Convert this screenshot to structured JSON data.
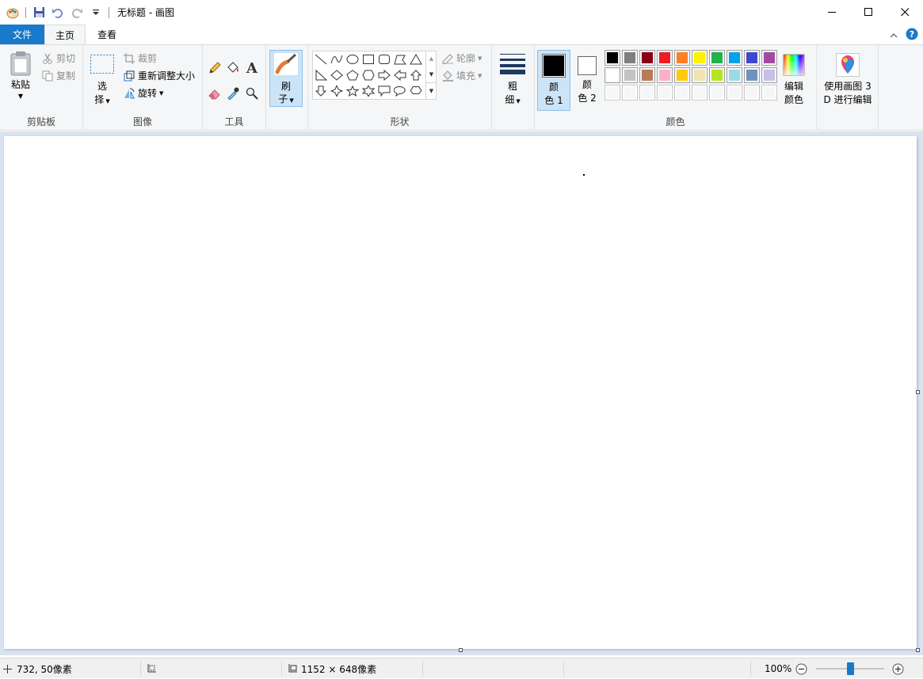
{
  "window": {
    "title": "无标题 - 画图",
    "minimize_glyph": "—",
    "maximize_glyph": "☐",
    "close_glyph": "✕"
  },
  "tabs": {
    "file": "文件",
    "home": "主页",
    "view": "查看"
  },
  "clipboard": {
    "paste": "粘贴",
    "cut": "剪切",
    "copy": "复制",
    "group_label": "剪贴板"
  },
  "image": {
    "select_line1": "选",
    "select_line2": "择",
    "crop": "裁剪",
    "resize": "重新调整大小",
    "rotate": "旋转",
    "group_label": "图像"
  },
  "tools": {
    "group_label": "工具",
    "text_glyph": "A"
  },
  "brushes": {
    "line1": "刷",
    "line2": "子"
  },
  "shapes": {
    "outline": "轮廓",
    "fill": "填充",
    "group_label": "形状"
  },
  "size": {
    "line1": "粗",
    "line2": "细"
  },
  "colors": {
    "color1_line1": "颜",
    "color1_line2": "色 1",
    "color2_line1": "颜",
    "color2_line2": "色 2",
    "edit_line1": "编辑",
    "edit_line2": "颜色",
    "group_label": "颜色",
    "color1_value": "#000000",
    "color2_value": "#ffffff",
    "palette_row1": [
      "#000000",
      "#7f7f7f",
      "#880015",
      "#ed1c24",
      "#ff7f27",
      "#fff200",
      "#22b14c",
      "#00a2e8",
      "#3f48cc",
      "#a349a4"
    ],
    "palette_row2": [
      "#ffffff",
      "#c3c3c3",
      "#b97a57",
      "#ffaec9",
      "#ffc90e",
      "#efe4b0",
      "#b5e61d",
      "#99d9ea",
      "#7092be",
      "#c8bfe7"
    ],
    "palette_row3": [
      "#f0f0f0",
      "#f0f0f0",
      "#f0f0f0",
      "#f0f0f0",
      "#f0f0f0",
      "#f0f0f0",
      "#f0f0f0",
      "#f0f0f0",
      "#f0f0f0",
      "#f0f0f0"
    ]
  },
  "paint3d": {
    "line1": "使用画图 3",
    "line2": "D 进行编辑"
  },
  "status": {
    "cursor": "732, 50像素",
    "canvas_size": "1152 × 648像素",
    "zoom": "100%",
    "zoom_level_fraction": 0.5
  }
}
